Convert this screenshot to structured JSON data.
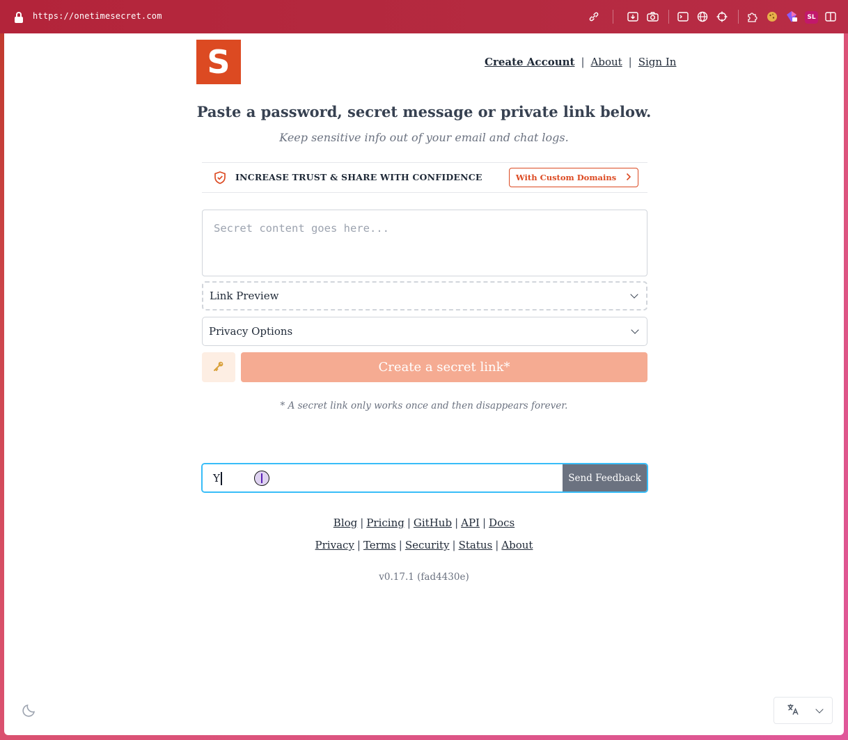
{
  "browser": {
    "url": "https://onetimesecret.com",
    "profile_initials": "SL"
  },
  "header": {
    "logo_letter": "S",
    "nav": {
      "create_account": "Create Account",
      "about": "About",
      "sign_in": "Sign In",
      "separator": "|"
    }
  },
  "main": {
    "headline": "Paste a password, secret message or private link below.",
    "subline": "Keep sensitive info out of your email and chat logs.",
    "trust_text": "INCREASE TRUST & SHARE WITH CONFIDENCE",
    "custom_domains_button": "With Custom Domains",
    "secret_placeholder": "Secret content goes here...",
    "link_preview_label": "Link Preview",
    "privacy_options_label": "Privacy Options",
    "create_button": "Create a secret link*",
    "footnote": "* A secret link only works once and then disappears forever."
  },
  "feedback": {
    "input_value": "Y",
    "button": "Send Feedback"
  },
  "footer": {
    "links_row1": [
      "Blog",
      "Pricing",
      "GitHub",
      "API",
      "Docs"
    ],
    "links_row2": [
      "Privacy",
      "Terms",
      "Security",
      "Status",
      "About"
    ],
    "version": "v0.17.1 (fad4430e)"
  },
  "colors": {
    "brand": "#dc4a22",
    "create_button_bg": "#f5ab92",
    "feedback_focus": "#38bdf8",
    "feedback_button": "#6b7280"
  },
  "icons": {
    "trust": "shield-check-icon",
    "key": "key-icon",
    "theme": "moon-icon",
    "language": "translate-icon"
  }
}
